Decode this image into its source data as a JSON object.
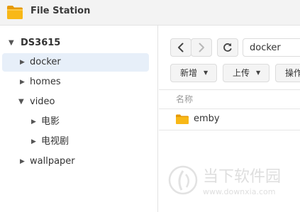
{
  "app": {
    "title": "File Station",
    "icon": "folder-icon",
    "accent_color": "#f6b21a"
  },
  "sidebar": {
    "root": {
      "label": "DS3615",
      "expanded": true
    },
    "items": [
      {
        "label": "docker",
        "expanded": false,
        "selected": true,
        "level": 1
      },
      {
        "label": "homes",
        "expanded": false,
        "selected": false,
        "level": 1
      },
      {
        "label": "video",
        "expanded": true,
        "selected": false,
        "level": 1
      },
      {
        "label": "电影",
        "expanded": false,
        "selected": false,
        "level": 2
      },
      {
        "label": "电视剧",
        "expanded": false,
        "selected": false,
        "level": 2
      },
      {
        "label": "wallpaper",
        "expanded": false,
        "selected": false,
        "level": 1
      }
    ],
    "selected_color": "#e7eff9"
  },
  "toolbar": {
    "back_icon": "chevron-left-icon",
    "forward_icon": "chevron-right-icon",
    "refresh_icon": "refresh-icon",
    "path_value": "docker",
    "create_label": "新增",
    "upload_label": "上传",
    "action_label": "操作"
  },
  "file_list": {
    "column_name": "名称",
    "rows": [
      {
        "name": "emby",
        "type": "folder"
      }
    ]
  },
  "watermark": {
    "text": "当下软件园",
    "url": "www.downxia.com"
  }
}
